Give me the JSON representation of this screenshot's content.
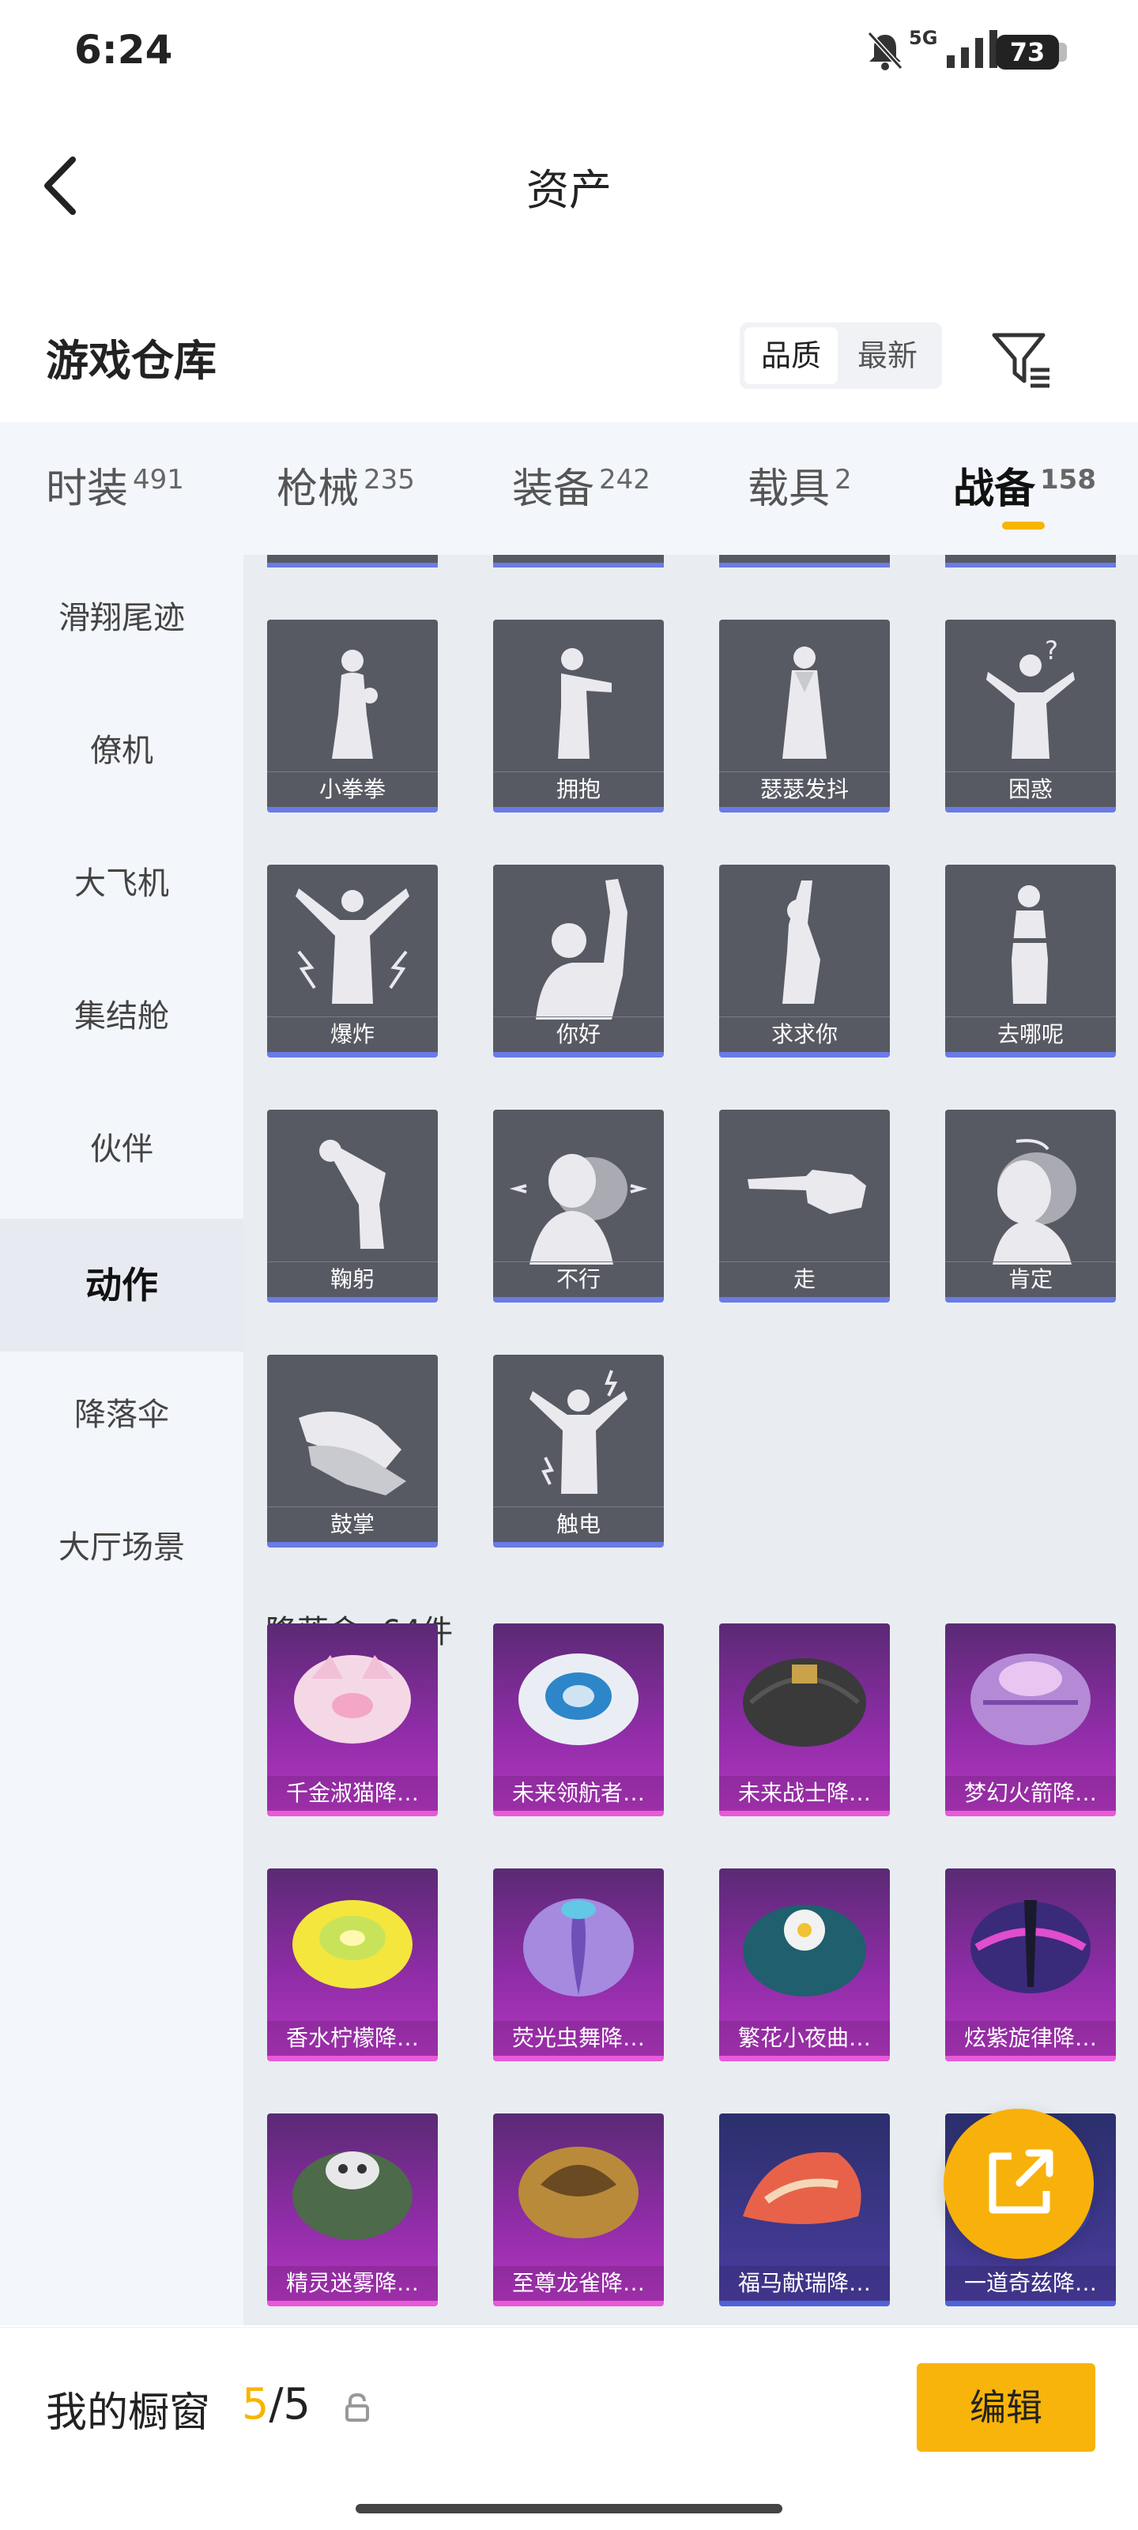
{
  "status_bar": {
    "time": "6:24",
    "network": "5G",
    "battery": "73",
    "icons": [
      "bell-muted-icon",
      "signal-icon",
      "battery-icon"
    ]
  },
  "header": {
    "title": "资产",
    "back_icon": "chevron-left-icon"
  },
  "warehouse": {
    "title": "游戏仓库",
    "sort_options": [
      "品质",
      "最新"
    ],
    "selected_sort": "品质",
    "filter_icon": "filter-icon"
  },
  "tabs": [
    {
      "label": "时装",
      "count": "491",
      "active": false
    },
    {
      "label": "枪械",
      "count": "235",
      "active": false
    },
    {
      "label": "装备",
      "count": "242",
      "active": false
    },
    {
      "label": "载具",
      "count": "2",
      "active": false
    },
    {
      "label": "战备",
      "count": "158",
      "active": true
    }
  ],
  "side_menu": {
    "items": [
      "滑翔尾迹",
      "僚机",
      "大飞机",
      "集结舱",
      "伙伴",
      "动作",
      "降落伞",
      "大厅场景"
    ],
    "active": "动作"
  },
  "actions": {
    "items": [
      "小拳拳",
      "拥抱",
      "瑟瑟发抖",
      "困惑",
      "爆炸",
      "你好",
      "求求你",
      "去哪呢",
      "鞠躬",
      "不行",
      "走",
      "肯定",
      "鼓掌",
      "触电"
    ]
  },
  "parachutes": {
    "heading": "降落伞: 64件",
    "items": [
      "千金淑猫降…",
      "未来领航者…",
      "未来战士降…",
      "梦幻火箭降…",
      "香水柠檬降…",
      "荧光虫舞降…",
      "繁花小夜曲…",
      "炫紫旋律降…",
      "精灵迷雾降…",
      "至尊龙雀降…",
      "福马献瑞降…",
      "一道奇兹降…"
    ]
  },
  "bottom_bar": {
    "showcase_label": "我的橱窗",
    "showcase_current": "5",
    "showcase_total": "/5",
    "edit_label": "编辑",
    "lock_icon": "lock-icon"
  },
  "colors": {
    "accent": "#f7b500",
    "action_card": "#585a63",
    "action_rarity": "#6a7be6",
    "parachute_rarity": "#e85ad8"
  }
}
